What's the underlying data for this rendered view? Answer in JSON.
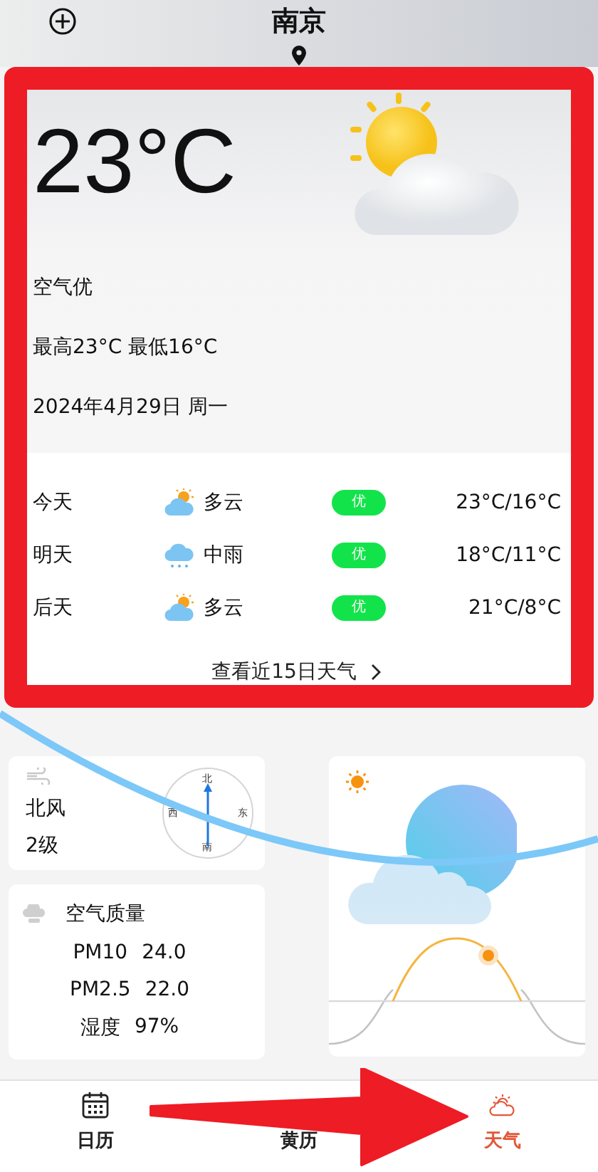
{
  "header": {
    "city": "南京"
  },
  "current": {
    "temperature": "23°C",
    "air": "空气优",
    "high_low": "最高23°C 最低16°C",
    "date": "2024年4月29日 周一"
  },
  "forecast": [
    {
      "day": "今天",
      "kind": "cloudy",
      "condition": "多云",
      "aqi": "优",
      "range": "23°C/16°C"
    },
    {
      "day": "明天",
      "kind": "rain",
      "condition": "中雨",
      "aqi": "优",
      "range": "18°C/11°C"
    },
    {
      "day": "后天",
      "kind": "cloudy",
      "condition": "多云",
      "aqi": "优",
      "range": "21°C/8°C"
    }
  ],
  "more_link": "查看近15日天气",
  "wind": {
    "direction": "北风",
    "level": "2级",
    "compass": {
      "north": "北",
      "west": "西",
      "east": "东",
      "south": "南"
    }
  },
  "air_quality": {
    "title": "空气质量",
    "items": [
      {
        "label": "PM10",
        "value": "24.0"
      },
      {
        "label": "PM2.5",
        "value": "22.0"
      },
      {
        "label": "湿度",
        "value": "97%"
      }
    ]
  },
  "tabs": [
    {
      "label": "日历",
      "kind": "calendar",
      "selected": false
    },
    {
      "label": "黄历",
      "kind": "none",
      "selected": false
    },
    {
      "label": "天气",
      "kind": "weather",
      "selected": true
    }
  ]
}
